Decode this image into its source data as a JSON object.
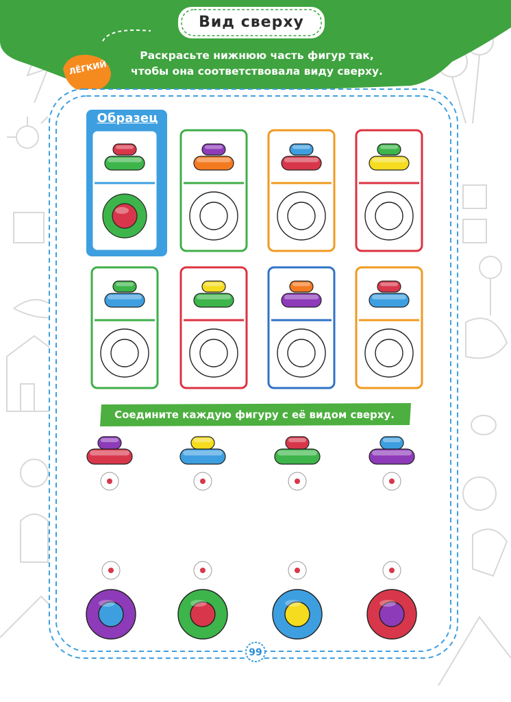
{
  "header": {
    "title": "Вид сверху",
    "instruction_line1": "Раскрасьте нижнюю часть фигур так,",
    "instruction_line2": "чтобы она соответствовала виду сверху.",
    "level_badge": "ЛЁГКИЙ"
  },
  "sample": {
    "label": "Образец"
  },
  "task1": {
    "cards": [
      {
        "border": "#3d9fe0",
        "top": "#d8374b",
        "base": "#3db54a",
        "sample": true,
        "view_outer": "#3db54a",
        "view_inner": "#d8374b"
      },
      {
        "border": "#3fae49",
        "top": "#8d3bb8",
        "base": "#f47a20"
      },
      {
        "border": "#f09a1f",
        "top": "#3d9fe0",
        "base": "#d8374b"
      },
      {
        "border": "#dc3240",
        "top": "#3db54a",
        "base": "#f5dc1e"
      },
      {
        "border": "#3fae49",
        "top": "#3db54a",
        "base": "#3d9fe0"
      },
      {
        "border": "#dc3240",
        "top": "#f5dc1e",
        "base": "#3db54a"
      },
      {
        "border": "#2f73c6",
        "top": "#f47a20",
        "base": "#8d3bb8"
      },
      {
        "border": "#f09a1f",
        "top": "#d8374b",
        "base": "#3d9fe0"
      }
    ]
  },
  "task2": {
    "label": "Соедините каждую фигуру с её видом сверху.",
    "figures": [
      {
        "top": "#8d3bb8",
        "base": "#d8374b"
      },
      {
        "top": "#f5dc1e",
        "base": "#3d9fe0"
      },
      {
        "top": "#d8374b",
        "base": "#3db54a"
      },
      {
        "top": "#3d9fe0",
        "base": "#8d3bb8"
      }
    ],
    "views": [
      {
        "outer": "#8d3bb8",
        "inner": "#3d9fe0"
      },
      {
        "outer": "#3db54a",
        "inner": "#d8374b"
      },
      {
        "outer": "#3d9fe0",
        "inner": "#f5dc1e"
      },
      {
        "outer": "#d8374b",
        "inner": "#8d3bb8"
      }
    ]
  },
  "footer": {
    "page_number": "99"
  },
  "colors": {
    "header_green": "#3fa33f",
    "frame_blue": "#3d9fe0",
    "label_green": "#4caf3f"
  }
}
